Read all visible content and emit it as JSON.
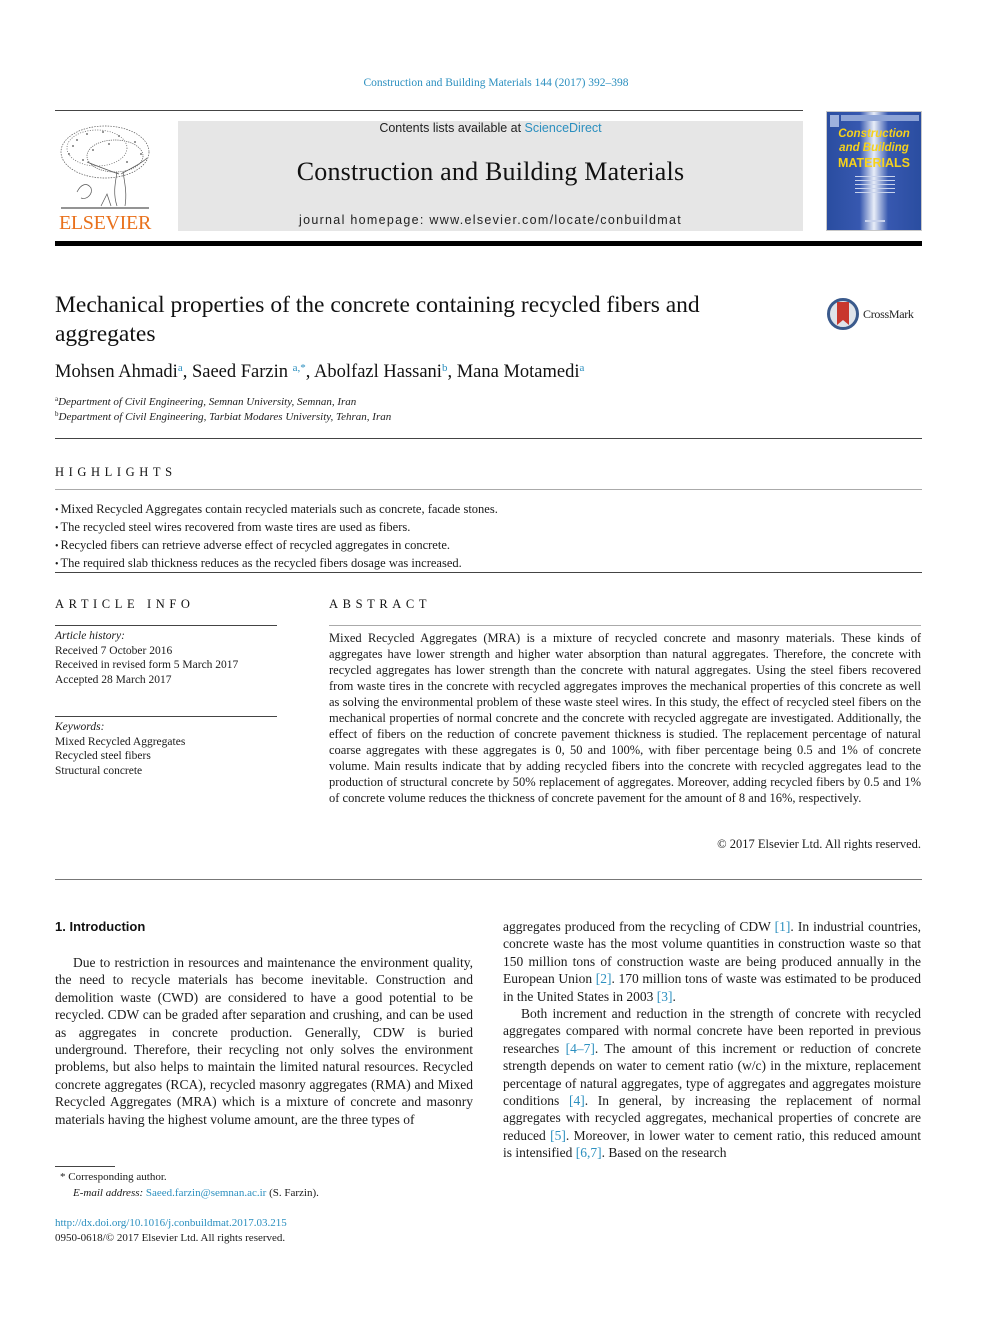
{
  "header": {
    "citation": "Construction and Building Materials 144 (2017) 392–398",
    "contents_prefix": "Contents lists available at ",
    "contents_link": "ScienceDirect",
    "journal_title": "Construction and Building Materials",
    "homepage": "journal homepage: www.elsevier.com/locate/conbuildmat",
    "publisher_logo_text": "ELSEVIER",
    "cover": {
      "title_line1": "Construction",
      "title_line2": "and Building",
      "title_line3": "MATERIALS"
    }
  },
  "colors": {
    "link": "#2b8fbf",
    "elsevier_orange": "#e9711c",
    "masthead_gray": "#e6e6e6",
    "cover_blue": "#2a4da0",
    "cover_yellow": "#f6d21c"
  },
  "article": {
    "title": "Mechanical properties of the concrete containing recycled fibers and aggregates",
    "crossmark_label": "CrossMark",
    "authors": [
      {
        "name": "Mohsen Ahmadi",
        "sup": "a"
      },
      {
        "name": "Saeed Farzin",
        "sup": "a,*"
      },
      {
        "name": "Abolfazl Hassani",
        "sup": "b"
      },
      {
        "name": "Mana Motamedi",
        "sup": "a"
      }
    ],
    "affiliations": [
      {
        "sup": "a",
        "text": "Department of Civil Engineering, Semnan University, Semnan, Iran"
      },
      {
        "sup": "b",
        "text": "Department of Civil Engineering, Tarbiat Modares University, Tehran, Iran"
      }
    ]
  },
  "highlights": {
    "heading": "HIGHLIGHTS",
    "items": [
      "Mixed Recycled Aggregates contain recycled materials such as concrete, facade stones.",
      "The recycled steel wires recovered from waste tires are used as fibers.",
      "Recycled fibers can retrieve adverse effect of recycled aggregates in concrete.",
      "The required slab thickness reduces as the recycled fibers dosage was increased."
    ]
  },
  "article_info": {
    "heading": "ARTICLE INFO",
    "history_label": "Article history:",
    "history": [
      "Received 7 October 2016",
      "Received in revised form 5 March 2017",
      "Accepted 28 March 2017"
    ],
    "keywords_label": "Keywords:",
    "keywords": [
      "Mixed Recycled Aggregates",
      "Recycled steel fibers",
      "Structural concrete"
    ]
  },
  "abstract": {
    "heading": "ABSTRACT",
    "text": "Mixed Recycled Aggregates (MRA) is a mixture of recycled concrete and masonry materials. These kinds of aggregates have lower strength and higher water absorption than natural aggregates. Therefore, the concrete with recycled aggregates has lower strength than the concrete with natural aggregates. Using the steel fibers recovered from waste tires in the concrete with recycled aggregates improves the mechanical properties of this concrete as well as solving the environmental problem of these waste steel wires. In this study, the effect of recycled steel fibers on the mechanical properties of normal concrete and the concrete with recycled aggregate are investigated. Additionally, the effect of fibers on the reduction of concrete pavement thickness is studied. The replacement percentage of natural coarse aggregates with these aggregates is 0, 50 and 100%, with fiber percentage being 0.5 and 1% of concrete volume. Main results indicate that by adding recycled fibers into the concrete with recycled aggregates lead to the production of structural concrete by 50% replacement of aggregates. Moreover, adding recycled fibers by 0.5 and 1% of concrete volume reduces the thickness of concrete pavement for the amount of 8 and 16%, respectively.",
    "copyright": "© 2017 Elsevier Ltd. All rights reserved."
  },
  "introduction": {
    "heading": "1. Introduction",
    "left_para": "Due to restriction in resources and maintenance the environment quality, the need to recycle materials has become inevitable. Construction and demolition waste (CWD) are considered to have a good potential to be recycled. CDW can be graded after separation and crushing, and can be used as aggregates in concrete production. Generally, CDW is buried underground. Therefore, their recycling not only solves the environment problems, but also helps to maintain the limited natural resources. Recycled concrete aggregates (RCA), recycled masonry aggregates (RMA) and Mixed Recycled Aggregates (MRA) which is a mixture of concrete and masonry materials having the highest volume amount, are the three types of",
    "right_para1": {
      "t1": "aggregates produced from the recycling of CDW ",
      "r1": "[1]",
      "t2": ". In industrial countries, concrete waste has the most volume quantities in construction waste so that 150 million tons of construction waste are being produced annually in the European Union ",
      "r2": "[2]",
      "t3": ". 170 million tons of waste was estimated to be produced in the United States in 2003 ",
      "r3": "[3]",
      "t4": "."
    },
    "right_para2": {
      "t1": "Both increment and reduction in the strength of concrete with recycled aggregates compared with normal concrete have been reported in previous researches ",
      "r1": "[4–7]",
      "t2": ". The amount of this increment or reduction of concrete strength depends on water to cement ratio (w/c) in the mixture, replacement percentage of natural aggregates, type of aggregates and aggregates moisture conditions ",
      "r2": "[4]",
      "t3": ". In general, by increasing the replacement of normal aggregates with recycled aggregates, mechanical properties of concrete are reduced ",
      "r3": "[5]",
      "t4": ". Moreover, in lower water to cement ratio, this reduced amount is intensified ",
      "r4": "[6,7]",
      "t5": ". Based on the research"
    }
  },
  "footnotes": {
    "corresponding": "* Corresponding author.",
    "email_label": "E-mail address: ",
    "email": "Saeed.farzin@semnan.ac.ir",
    "email_suffix": " (S. Farzin).",
    "doi": "http://dx.doi.org/10.1016/j.conbuildmat.2017.03.215",
    "issn": "0950-0618/© 2017 Elsevier Ltd. All rights reserved."
  }
}
